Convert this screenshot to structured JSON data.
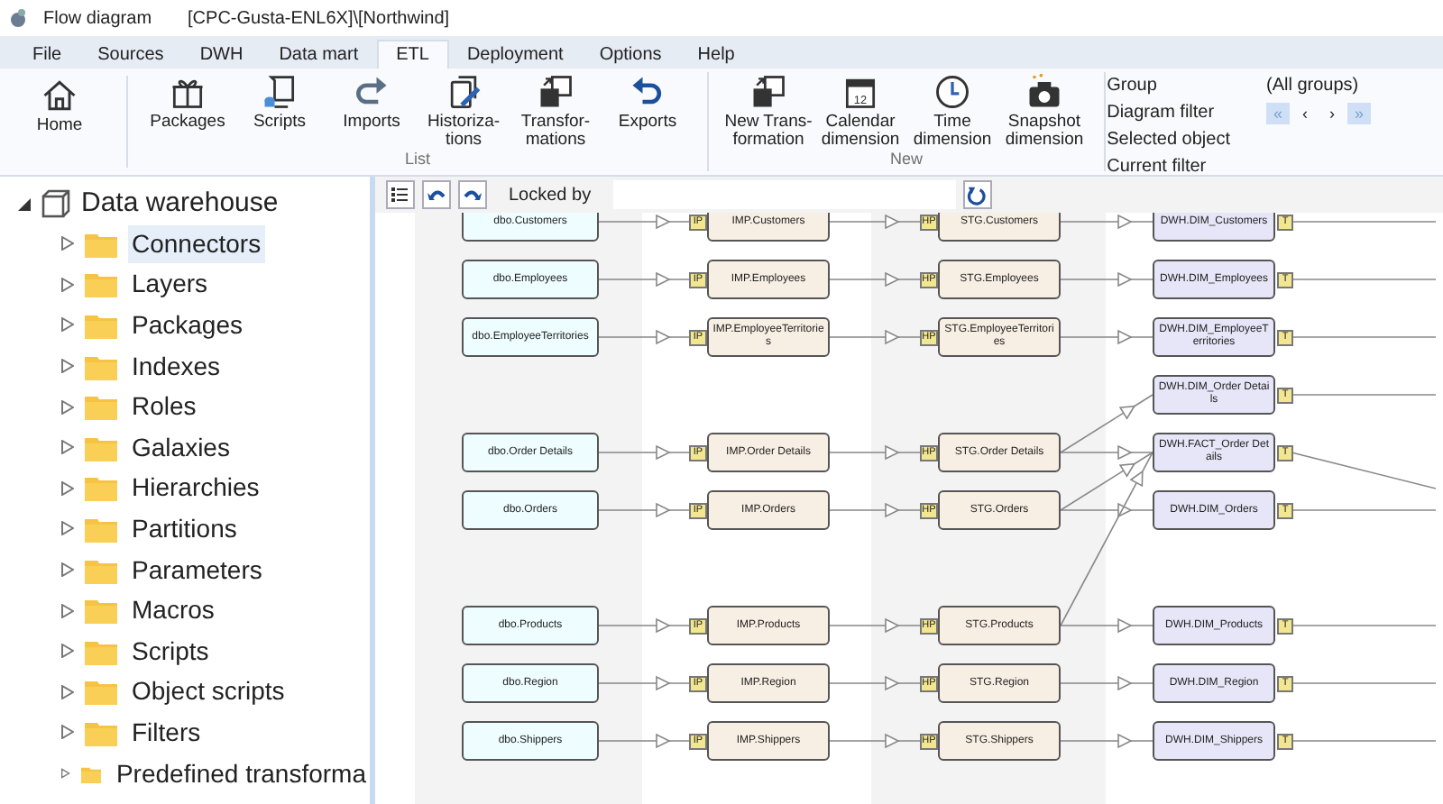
{
  "window": {
    "title": "Flow diagram",
    "path": "[CPC-Gusta-ENL6X]\\[Northwind]"
  },
  "menu_tabs": [
    {
      "label": "File",
      "selected": false
    },
    {
      "label": "Sources",
      "selected": false
    },
    {
      "label": "DWH",
      "selected": false
    },
    {
      "label": "Data mart",
      "selected": false
    },
    {
      "label": "ETL",
      "selected": true
    },
    {
      "label": "Deployment",
      "selected": false
    },
    {
      "label": "Options",
      "selected": false
    },
    {
      "label": "Help",
      "selected": false
    }
  ],
  "ribbon": {
    "home": {
      "label": "Home",
      "kind": "home"
    },
    "groups": [
      {
        "title": "List",
        "buttons": [
          {
            "label": "Packages",
            "kind": "gift"
          },
          {
            "label": "Scripts",
            "kind": "scroll"
          },
          {
            "label": "Imports",
            "kind": "redo"
          },
          {
            "label": "Historiza-\ntions",
            "kind": "pencil"
          },
          {
            "label": "Transfor-\nmations",
            "kind": "copy"
          },
          {
            "label": "Exports",
            "kind": "undo"
          }
        ]
      },
      {
        "title": "New",
        "buttons": [
          {
            "label": "New Trans-\nformation",
            "kind": "copy"
          },
          {
            "label": "Calendar\ndimension",
            "kind": "calendar"
          },
          {
            "label": "Time\ndimension",
            "kind": "clock"
          },
          {
            "label": "Snapshot\ndimension",
            "kind": "camera"
          }
        ]
      }
    ],
    "calendar_day": "12",
    "info": [
      {
        "label": "Group",
        "value": "(All groups)"
      },
      {
        "label": "Diagram filter",
        "nav": [
          "«",
          "‹",
          "›",
          "»"
        ]
      },
      {
        "label": "Selected object"
      },
      {
        "label": "Current filter"
      }
    ]
  },
  "tree": {
    "label": "Data warehouse",
    "expanded": true,
    "children": [
      {
        "label": "Connectors",
        "selected": true
      },
      {
        "label": "Layers",
        "selected": false
      },
      {
        "label": "Packages",
        "selected": false
      },
      {
        "label": "Indexes",
        "selected": false
      },
      {
        "label": "Roles",
        "selected": false
      },
      {
        "label": "Galaxies",
        "selected": false
      },
      {
        "label": "Hierarchies",
        "selected": false
      },
      {
        "label": "Partitions",
        "selected": false
      },
      {
        "label": "Parameters",
        "selected": false
      },
      {
        "label": "Macros",
        "selected": false
      },
      {
        "label": "Scripts",
        "selected": false
      },
      {
        "label": "Object scripts",
        "selected": false
      },
      {
        "label": "Filters",
        "selected": false
      },
      {
        "label": "Predefined transforma",
        "selected": false
      }
    ]
  },
  "diagram_toolbar": {
    "locked_by_label": "Locked by"
  },
  "diagram": {
    "rows": [
      {
        "source": "dbo.Customers",
        "imp": {
          "label": "IMP.Customers",
          "tag": "IP"
        },
        "stg": {
          "label": "STG.Customers",
          "tag": "HP"
        },
        "dwh": {
          "label": "DWH.DIM_Customers",
          "tag": "T"
        }
      },
      {
        "source": "dbo.Employees",
        "imp": {
          "label": "IMP.Employees",
          "tag": "IP"
        },
        "stg": {
          "label": "STG.Employees",
          "tag": "HP"
        },
        "dwh": {
          "label": "DWH.DIM_Employees",
          "tag": "T"
        }
      },
      {
        "source": "dbo.EmployeeTerritories",
        "imp": {
          "label": "IMP.EmployeeTerritories",
          "tag": "IP"
        },
        "stg": {
          "label": "STG.EmployeeTerritories",
          "tag": "HP"
        },
        "dwh": {
          "label": "DWH.DIM_EmployeeTerritories",
          "tag": "T"
        }
      },
      {
        "dwh": {
          "label": "DWH.DIM_Order Details",
          "tag": "T"
        }
      },
      {
        "source": "dbo.Order Details",
        "imp": {
          "label": "IMP.Order Details",
          "tag": "IP"
        },
        "stg": {
          "label": "STG.Order Details",
          "tag": "HP"
        },
        "dwh": {
          "label": "DWH.FACT_Order Details",
          "tag": "T"
        }
      },
      {
        "source": "dbo.Orders",
        "imp": {
          "label": "IMP.Orders",
          "tag": "IP"
        },
        "stg": {
          "label": "STG.Orders",
          "tag": "HP"
        },
        "dwh": {
          "label": "DWH.DIM_Orders",
          "tag": "T"
        }
      },
      {
        "gap_before": true,
        "source": "dbo.Products",
        "imp": {
          "label": "IMP.Products",
          "tag": "IP"
        },
        "stg": {
          "label": "STG.Products",
          "tag": "HP"
        },
        "dwh": {
          "label": "DWH.DIM_Products",
          "tag": "T"
        }
      },
      {
        "source": "dbo.Region",
        "imp": {
          "label": "IMP.Region",
          "tag": "IP"
        },
        "stg": {
          "label": "STG.Region",
          "tag": "HP"
        },
        "dwh": {
          "label": "DWH.DIM_Region",
          "tag": "T"
        }
      },
      {
        "source": "dbo.Shippers",
        "imp": {
          "label": "IMP.Shippers",
          "tag": "IP"
        },
        "stg": {
          "label": "STG.Shippers",
          "tag": "HP"
        },
        "dwh": {
          "label": "DWH.DIM_Shippers",
          "tag": "T"
        }
      }
    ]
  }
}
